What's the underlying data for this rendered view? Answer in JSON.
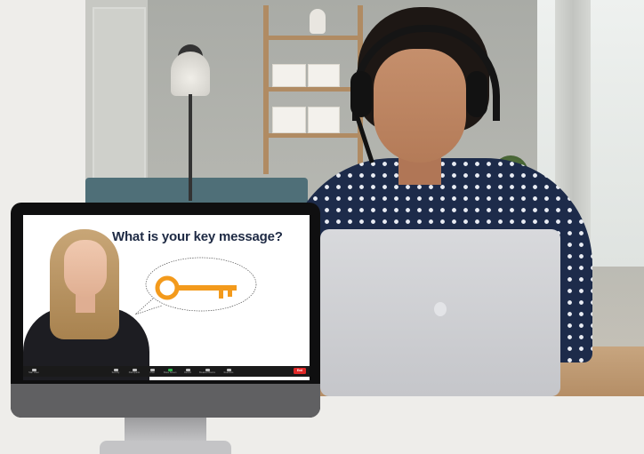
{
  "slide": {
    "title": "What is your key message?"
  },
  "zoom_toolbar": {
    "buttons": [
      {
        "label": "Start Video",
        "icon": "video-camera-icon"
      },
      {
        "label": "Security",
        "icon": "shield-icon"
      },
      {
        "label": "Participants",
        "icon": "participants-icon"
      },
      {
        "label": "Chat",
        "icon": "chat-icon"
      },
      {
        "label": "Share Screen",
        "icon": "share-screen-icon"
      },
      {
        "label": "Record",
        "icon": "record-icon"
      },
      {
        "label": "Breakout Rooms",
        "icon": "breakout-rooms-icon"
      },
      {
        "label": "Reactions",
        "icon": "reactions-icon"
      }
    ],
    "end_label": "End"
  },
  "colors": {
    "title_text": "#1e2a44",
    "key": "#f39a1c",
    "end_button": "#e02828",
    "share_button": "#2bb34a",
    "background": "#eeedea"
  }
}
